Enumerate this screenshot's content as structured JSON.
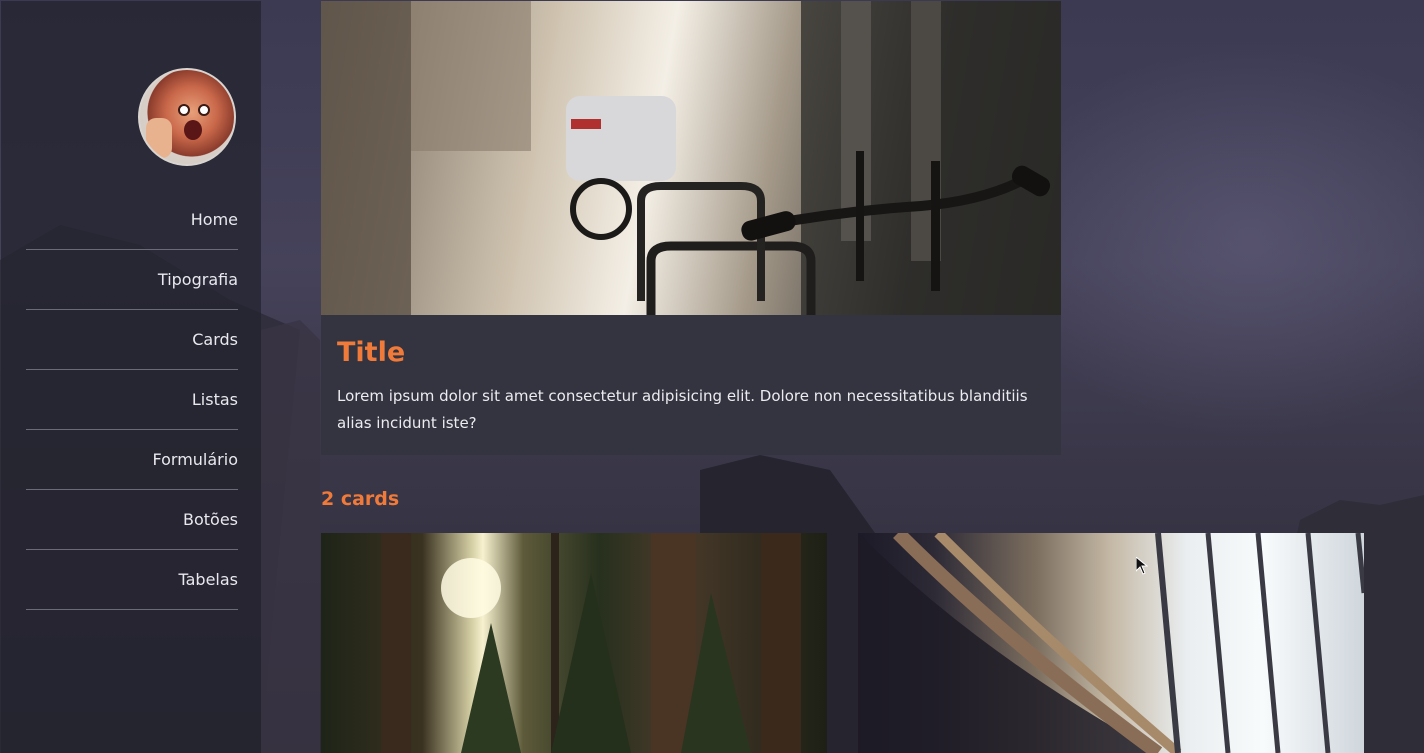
{
  "nav": {
    "items": [
      {
        "label": "Home"
      },
      {
        "label": "Tipografia"
      },
      {
        "label": "Cards"
      },
      {
        "label": "Listas"
      },
      {
        "label": "Formulário"
      },
      {
        "label": "Botões"
      },
      {
        "label": "Tabelas"
      }
    ]
  },
  "main_card": {
    "title": "Title",
    "text": "Lorem ipsum dolor sit amet consectetur adipisicing elit. Dolore non necessitatibus blanditiis alias incidunt iste?"
  },
  "section": {
    "title": "2 cards"
  },
  "colors": {
    "accent": "#f07a3a",
    "sidebar": "#242430",
    "card_bg": "#33343f",
    "nav_text": "#e8e8ee",
    "divider": "#6b6b78"
  }
}
